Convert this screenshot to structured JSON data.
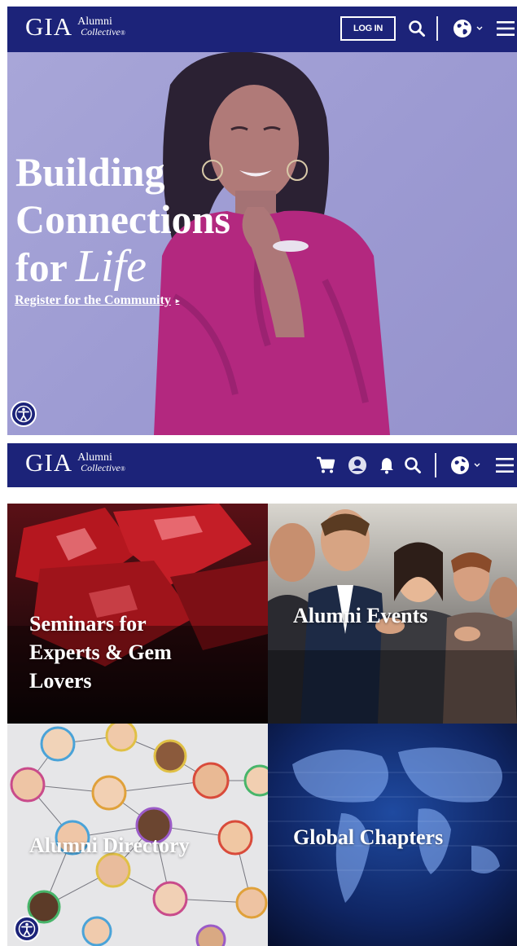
{
  "brand": {
    "logo_main": "GIA",
    "logo_sub_1": "Alumni",
    "logo_sub_2": "Collective",
    "logo_mark": "®",
    "color_navy": "#1c2379"
  },
  "header_top": {
    "login_label": "LOG IN",
    "icons": [
      "search-icon",
      "globe-icon",
      "chevron-down-icon",
      "menu-icon"
    ]
  },
  "hero": {
    "title_line1": "Building",
    "title_line2": "Connections",
    "title_line3_word": "for",
    "title_line3_script": "Life",
    "cta_label": "Register for the Community",
    "cta_arrow": "▸"
  },
  "header_second": {
    "icons": [
      "cart-icon",
      "user-icon",
      "bell-icon",
      "search-icon",
      "globe-icon",
      "chevron-down-icon",
      "menu-icon"
    ]
  },
  "tiles": [
    {
      "label_lines": [
        "Seminars for",
        "Experts & Gem",
        "Lovers"
      ],
      "image": "red-gemstones"
    },
    {
      "label_lines": [
        "Alumni Events"
      ],
      "image": "applauding-audience"
    },
    {
      "label_lines": [
        "Alumni Directory"
      ],
      "image": "connected-faces-network"
    },
    {
      "label_lines": [
        "Global Chapters"
      ],
      "image": "digital-world-map"
    }
  ],
  "accessibility": {
    "icon": "accessibility-icon"
  }
}
